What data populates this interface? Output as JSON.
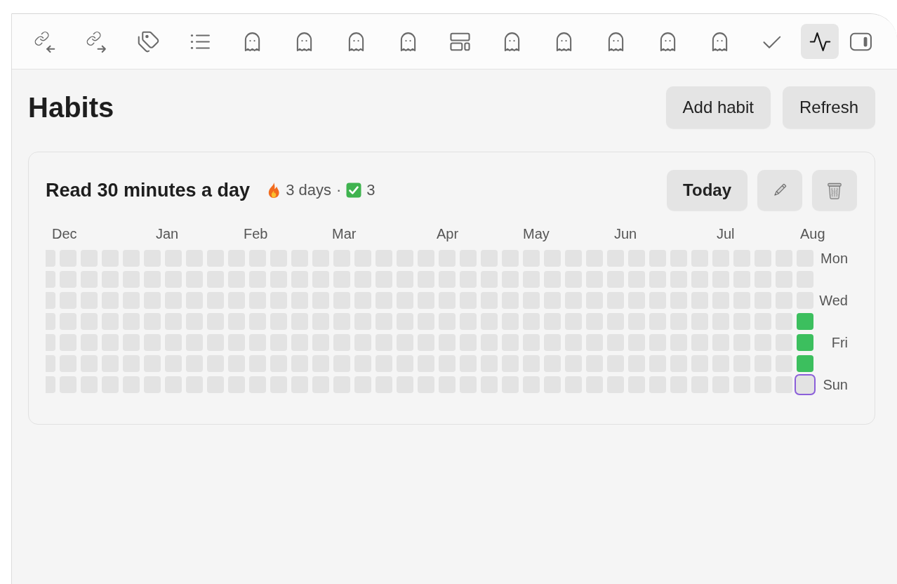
{
  "toolbar": {
    "buttons": [
      {
        "kind": "link-in",
        "selected": false
      },
      {
        "kind": "link-out",
        "selected": false
      },
      {
        "kind": "tags",
        "selected": false
      },
      {
        "kind": "list",
        "selected": false
      },
      {
        "kind": "ghost",
        "selected": false
      },
      {
        "kind": "ghost",
        "selected": false
      },
      {
        "kind": "ghost",
        "selected": false
      },
      {
        "kind": "ghost",
        "selected": false
      },
      {
        "kind": "layout",
        "selected": false
      },
      {
        "kind": "ghost",
        "selected": false
      },
      {
        "kind": "ghost",
        "selected": false
      },
      {
        "kind": "ghost",
        "selected": false
      },
      {
        "kind": "ghost",
        "selected": false
      },
      {
        "kind": "ghost",
        "selected": false
      },
      {
        "kind": "check",
        "selected": false
      },
      {
        "kind": "pulse",
        "selected": true
      },
      {
        "kind": "sidebar",
        "selected": false
      }
    ]
  },
  "page": {
    "title": "Habits",
    "buttons": [
      "Add habit",
      "Refresh"
    ]
  },
  "habits": [
    {
      "name": "Read 30 minutes a day",
      "streak": "3 days",
      "separator": "·",
      "completions": "3",
      "buttons": [
        {
          "kind": "text",
          "label": "Today"
        },
        {
          "kind": "edit"
        },
        {
          "kind": "delete"
        }
      ],
      "months": [
        "Dec",
        "Jan",
        "Feb",
        "Mar",
        "Apr",
        "May",
        "Jun",
        "Jul",
        "Aug"
      ],
      "weekday_labels": [
        "Mon",
        "Wed",
        "Fri",
        "Sun"
      ],
      "weeks": [
        [
          {
            "done": false,
            "today": false
          },
          {
            "done": false,
            "today": false
          },
          {
            "done": false,
            "today": false
          },
          {
            "done": false,
            "today": false
          },
          {
            "done": false,
            "today": false
          },
          {
            "done": false,
            "today": false
          },
          {
            "done": false,
            "today": false
          }
        ],
        [
          {
            "done": false,
            "today": false
          },
          {
            "done": false,
            "today": false
          },
          {
            "done": false,
            "today": false
          },
          {
            "done": false,
            "today": false
          },
          {
            "done": false,
            "today": false
          },
          {
            "done": false,
            "today": false
          },
          {
            "done": false,
            "today": false
          }
        ],
        [
          {
            "done": false,
            "today": false
          },
          {
            "done": false,
            "today": false
          },
          {
            "done": false,
            "today": false
          },
          {
            "done": false,
            "today": false
          },
          {
            "done": false,
            "today": false
          },
          {
            "done": false,
            "today": false
          },
          {
            "done": false,
            "today": false
          }
        ],
        [
          {
            "done": false,
            "today": false
          },
          {
            "done": false,
            "today": false
          },
          {
            "done": false,
            "today": false
          },
          {
            "done": false,
            "today": false
          },
          {
            "done": false,
            "today": false
          },
          {
            "done": false,
            "today": false
          },
          {
            "done": false,
            "today": false
          }
        ],
        [
          {
            "done": false,
            "today": false
          },
          {
            "done": false,
            "today": false
          },
          {
            "done": false,
            "today": false
          },
          {
            "done": false,
            "today": false
          },
          {
            "done": false,
            "today": false
          },
          {
            "done": false,
            "today": false
          },
          {
            "done": false,
            "today": false
          }
        ],
        [
          {
            "done": false,
            "today": false
          },
          {
            "done": false,
            "today": false
          },
          {
            "done": false,
            "today": false
          },
          {
            "done": false,
            "today": false
          },
          {
            "done": false,
            "today": false
          },
          {
            "done": false,
            "today": false
          },
          {
            "done": false,
            "today": false
          }
        ],
        [
          {
            "done": false,
            "today": false
          },
          {
            "done": false,
            "today": false
          },
          {
            "done": false,
            "today": false
          },
          {
            "done": false,
            "today": false
          },
          {
            "done": false,
            "today": false
          },
          {
            "done": false,
            "today": false
          },
          {
            "done": false,
            "today": false
          }
        ],
        [
          {
            "done": false,
            "today": false
          },
          {
            "done": false,
            "today": false
          },
          {
            "done": false,
            "today": false
          },
          {
            "done": false,
            "today": false
          },
          {
            "done": false,
            "today": false
          },
          {
            "done": false,
            "today": false
          },
          {
            "done": false,
            "today": false
          }
        ],
        [
          {
            "done": false,
            "today": false
          },
          {
            "done": false,
            "today": false
          },
          {
            "done": false,
            "today": false
          },
          {
            "done": false,
            "today": false
          },
          {
            "done": false,
            "today": false
          },
          {
            "done": false,
            "today": false
          },
          {
            "done": false,
            "today": false
          }
        ],
        [
          {
            "done": false,
            "today": false
          },
          {
            "done": false,
            "today": false
          },
          {
            "done": false,
            "today": false
          },
          {
            "done": false,
            "today": false
          },
          {
            "done": false,
            "today": false
          },
          {
            "done": false,
            "today": false
          },
          {
            "done": false,
            "today": false
          }
        ],
        [
          {
            "done": false,
            "today": false
          },
          {
            "done": false,
            "today": false
          },
          {
            "done": false,
            "today": false
          },
          {
            "done": false,
            "today": false
          },
          {
            "done": false,
            "today": false
          },
          {
            "done": false,
            "today": false
          },
          {
            "done": false,
            "today": false
          }
        ],
        [
          {
            "done": false,
            "today": false
          },
          {
            "done": false,
            "today": false
          },
          {
            "done": false,
            "today": false
          },
          {
            "done": false,
            "today": false
          },
          {
            "done": false,
            "today": false
          },
          {
            "done": false,
            "today": false
          },
          {
            "done": false,
            "today": false
          }
        ],
        [
          {
            "done": false,
            "today": false
          },
          {
            "done": false,
            "today": false
          },
          {
            "done": false,
            "today": false
          },
          {
            "done": false,
            "today": false
          },
          {
            "done": false,
            "today": false
          },
          {
            "done": false,
            "today": false
          },
          {
            "done": false,
            "today": false
          }
        ],
        [
          {
            "done": false,
            "today": false
          },
          {
            "done": false,
            "today": false
          },
          {
            "done": false,
            "today": false
          },
          {
            "done": false,
            "today": false
          },
          {
            "done": false,
            "today": false
          },
          {
            "done": false,
            "today": false
          },
          {
            "done": false,
            "today": false
          }
        ],
        [
          {
            "done": false,
            "today": false
          },
          {
            "done": false,
            "today": false
          },
          {
            "done": false,
            "today": false
          },
          {
            "done": false,
            "today": false
          },
          {
            "done": false,
            "today": false
          },
          {
            "done": false,
            "today": false
          },
          {
            "done": false,
            "today": false
          }
        ],
        [
          {
            "done": false,
            "today": false
          },
          {
            "done": false,
            "today": false
          },
          {
            "done": false,
            "today": false
          },
          {
            "done": false,
            "today": false
          },
          {
            "done": false,
            "today": false
          },
          {
            "done": false,
            "today": false
          },
          {
            "done": false,
            "today": false
          }
        ],
        [
          {
            "done": false,
            "today": false
          },
          {
            "done": false,
            "today": false
          },
          {
            "done": false,
            "today": false
          },
          {
            "done": false,
            "today": false
          },
          {
            "done": false,
            "today": false
          },
          {
            "done": false,
            "today": false
          },
          {
            "done": false,
            "today": false
          }
        ],
        [
          {
            "done": false,
            "today": false
          },
          {
            "done": false,
            "today": false
          },
          {
            "done": false,
            "today": false
          },
          {
            "done": false,
            "today": false
          },
          {
            "done": false,
            "today": false
          },
          {
            "done": false,
            "today": false
          },
          {
            "done": false,
            "today": false
          }
        ],
        [
          {
            "done": false,
            "today": false
          },
          {
            "done": false,
            "today": false
          },
          {
            "done": false,
            "today": false
          },
          {
            "done": false,
            "today": false
          },
          {
            "done": false,
            "today": false
          },
          {
            "done": false,
            "today": false
          },
          {
            "done": false,
            "today": false
          }
        ],
        [
          {
            "done": false,
            "today": false
          },
          {
            "done": false,
            "today": false
          },
          {
            "done": false,
            "today": false
          },
          {
            "done": false,
            "today": false
          },
          {
            "done": false,
            "today": false
          },
          {
            "done": false,
            "today": false
          },
          {
            "done": false,
            "today": false
          }
        ],
        [
          {
            "done": false,
            "today": false
          },
          {
            "done": false,
            "today": false
          },
          {
            "done": false,
            "today": false
          },
          {
            "done": false,
            "today": false
          },
          {
            "done": false,
            "today": false
          },
          {
            "done": false,
            "today": false
          },
          {
            "done": false,
            "today": false
          }
        ],
        [
          {
            "done": false,
            "today": false
          },
          {
            "done": false,
            "today": false
          },
          {
            "done": false,
            "today": false
          },
          {
            "done": false,
            "today": false
          },
          {
            "done": false,
            "today": false
          },
          {
            "done": false,
            "today": false
          },
          {
            "done": false,
            "today": false
          }
        ],
        [
          {
            "done": false,
            "today": false
          },
          {
            "done": false,
            "today": false
          },
          {
            "done": false,
            "today": false
          },
          {
            "done": false,
            "today": false
          },
          {
            "done": false,
            "today": false
          },
          {
            "done": false,
            "today": false
          },
          {
            "done": false,
            "today": false
          }
        ],
        [
          {
            "done": false,
            "today": false
          },
          {
            "done": false,
            "today": false
          },
          {
            "done": false,
            "today": false
          },
          {
            "done": false,
            "today": false
          },
          {
            "done": false,
            "today": false
          },
          {
            "done": false,
            "today": false
          },
          {
            "done": false,
            "today": false
          }
        ],
        [
          {
            "done": false,
            "today": false
          },
          {
            "done": false,
            "today": false
          },
          {
            "done": false,
            "today": false
          },
          {
            "done": false,
            "today": false
          },
          {
            "done": false,
            "today": false
          },
          {
            "done": false,
            "today": false
          },
          {
            "done": false,
            "today": false
          }
        ],
        [
          {
            "done": false,
            "today": false
          },
          {
            "done": false,
            "today": false
          },
          {
            "done": false,
            "today": false
          },
          {
            "done": false,
            "today": false
          },
          {
            "done": false,
            "today": false
          },
          {
            "done": false,
            "today": false
          },
          {
            "done": false,
            "today": false
          }
        ],
        [
          {
            "done": false,
            "today": false
          },
          {
            "done": false,
            "today": false
          },
          {
            "done": false,
            "today": false
          },
          {
            "done": false,
            "today": false
          },
          {
            "done": false,
            "today": false
          },
          {
            "done": false,
            "today": false
          },
          {
            "done": false,
            "today": false
          }
        ],
        [
          {
            "done": false,
            "today": false
          },
          {
            "done": false,
            "today": false
          },
          {
            "done": false,
            "today": false
          },
          {
            "done": false,
            "today": false
          },
          {
            "done": false,
            "today": false
          },
          {
            "done": false,
            "today": false
          },
          {
            "done": false,
            "today": false
          }
        ],
        [
          {
            "done": false,
            "today": false
          },
          {
            "done": false,
            "today": false
          },
          {
            "done": false,
            "today": false
          },
          {
            "done": false,
            "today": false
          },
          {
            "done": false,
            "today": false
          },
          {
            "done": false,
            "today": false
          },
          {
            "done": false,
            "today": false
          }
        ],
        [
          {
            "done": false,
            "today": false
          },
          {
            "done": false,
            "today": false
          },
          {
            "done": false,
            "today": false
          },
          {
            "done": false,
            "today": false
          },
          {
            "done": false,
            "today": false
          },
          {
            "done": false,
            "today": false
          },
          {
            "done": false,
            "today": false
          }
        ],
        [
          {
            "done": false,
            "today": false
          },
          {
            "done": false,
            "today": false
          },
          {
            "done": false,
            "today": false
          },
          {
            "done": false,
            "today": false
          },
          {
            "done": false,
            "today": false
          },
          {
            "done": false,
            "today": false
          },
          {
            "done": false,
            "today": false
          }
        ],
        [
          {
            "done": false,
            "today": false
          },
          {
            "done": false,
            "today": false
          },
          {
            "done": false,
            "today": false
          },
          {
            "done": false,
            "today": false
          },
          {
            "done": false,
            "today": false
          },
          {
            "done": false,
            "today": false
          },
          {
            "done": false,
            "today": false
          }
        ],
        [
          {
            "done": false,
            "today": false
          },
          {
            "done": false,
            "today": false
          },
          {
            "done": false,
            "today": false
          },
          {
            "done": false,
            "today": false
          },
          {
            "done": false,
            "today": false
          },
          {
            "done": false,
            "today": false
          },
          {
            "done": false,
            "today": false
          }
        ],
        [
          {
            "done": false,
            "today": false
          },
          {
            "done": false,
            "today": false
          },
          {
            "done": false,
            "today": false
          },
          {
            "done": false,
            "today": false
          },
          {
            "done": false,
            "today": false
          },
          {
            "done": false,
            "today": false
          },
          {
            "done": false,
            "today": false
          }
        ],
        [
          {
            "done": false,
            "today": false
          },
          {
            "done": false,
            "today": false
          },
          {
            "done": false,
            "today": false
          },
          {
            "done": false,
            "today": false
          },
          {
            "done": false,
            "today": false
          },
          {
            "done": false,
            "today": false
          },
          {
            "done": false,
            "today": false
          }
        ],
        [
          {
            "done": false,
            "today": false
          },
          {
            "done": false,
            "today": false
          },
          {
            "done": false,
            "today": false
          },
          {
            "done": false,
            "today": false
          },
          {
            "done": false,
            "today": false
          },
          {
            "done": false,
            "today": false
          },
          {
            "done": false,
            "today": false
          }
        ],
        [
          {
            "done": false,
            "today": false
          },
          {
            "done": false,
            "today": false
          },
          {
            "done": false,
            "today": false
          },
          {
            "done": true,
            "today": false
          },
          {
            "done": true,
            "today": false
          },
          {
            "done": true,
            "today": false
          },
          {
            "done": false,
            "today": true
          }
        ]
      ]
    }
  ]
}
